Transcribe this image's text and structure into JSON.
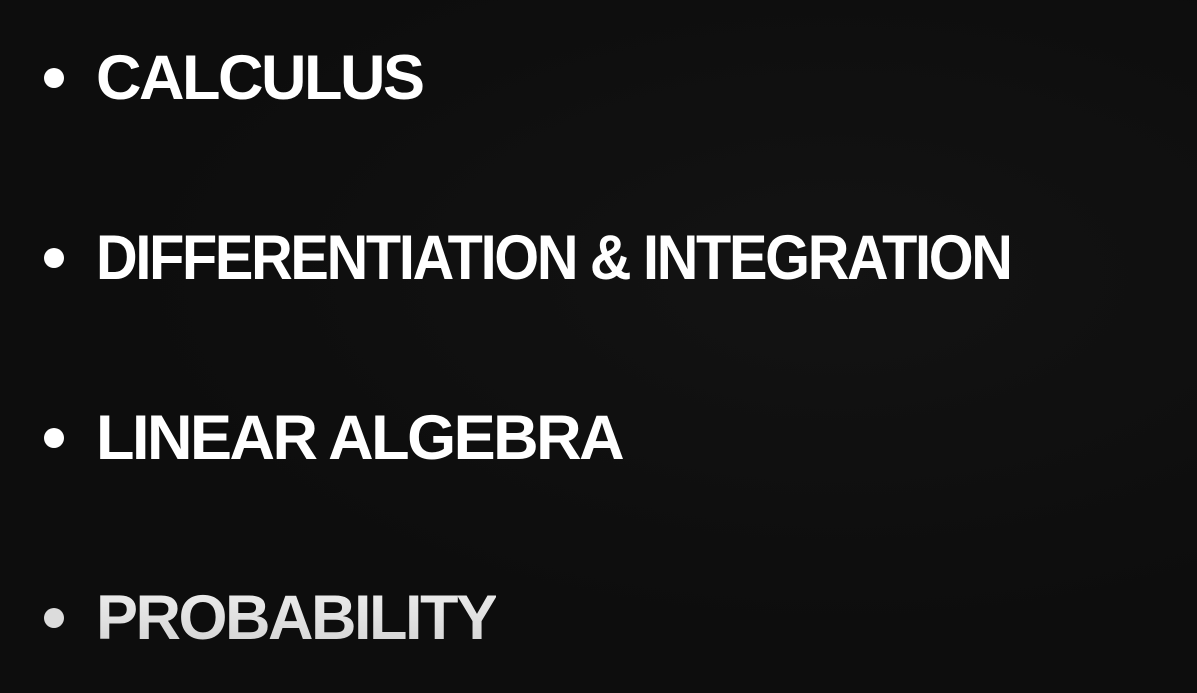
{
  "topics": {
    "items": [
      {
        "label": "CALCULUS"
      },
      {
        "label": "DIFFERENTIATION & INTEGRATION"
      },
      {
        "label": "LINEAR ALGEBRA"
      },
      {
        "label": "PROBABILITY"
      }
    ]
  },
  "colors": {
    "background": "#0d0d0d",
    "text": "#ffffff",
    "faded_text": "#e2e2e2"
  },
  "icons": {
    "bullet": "bullet-dot-icon"
  }
}
